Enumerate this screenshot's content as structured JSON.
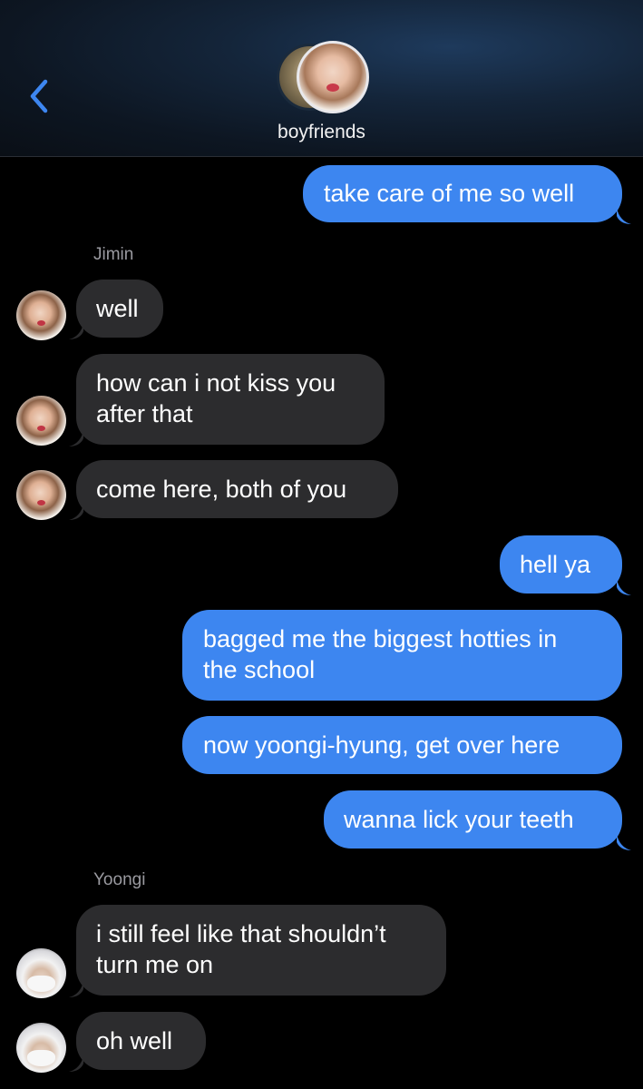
{
  "header": {
    "group_name": "boyfriends",
    "back_icon": "chevron-left-icon",
    "accent_color": "#3d86f0"
  },
  "colors": {
    "outgoing_bubble": "#3d86f0",
    "incoming_bubble": "#2c2c2e",
    "background": "#000000",
    "sender_label": "#9a9aa0"
  },
  "senders": {
    "jimin": "Jimin",
    "yoongi": "Yoongi"
  },
  "messages": [
    {
      "direction": "out",
      "text": "take care of me so well"
    },
    {
      "direction": "in",
      "sender": "Jimin",
      "text": "well"
    },
    {
      "direction": "in",
      "sender": "Jimin",
      "line1": "how can i not kiss you",
      "line2": "after that"
    },
    {
      "direction": "in",
      "sender": "Jimin",
      "text": "come here, both of you"
    },
    {
      "direction": "out",
      "text": "hell ya"
    },
    {
      "direction": "out",
      "line1": "bagged me the biggest hotties in",
      "line2": "the school"
    },
    {
      "direction": "out",
      "text": "now yoongi-hyung, get over here"
    },
    {
      "direction": "out",
      "text": "wanna lick your teeth"
    },
    {
      "direction": "in",
      "sender": "Yoongi",
      "line1": "i still feel like that shouldn’t",
      "line2": "turn me on"
    },
    {
      "direction": "in",
      "sender": "Yoongi",
      "text": "oh well"
    }
  ]
}
